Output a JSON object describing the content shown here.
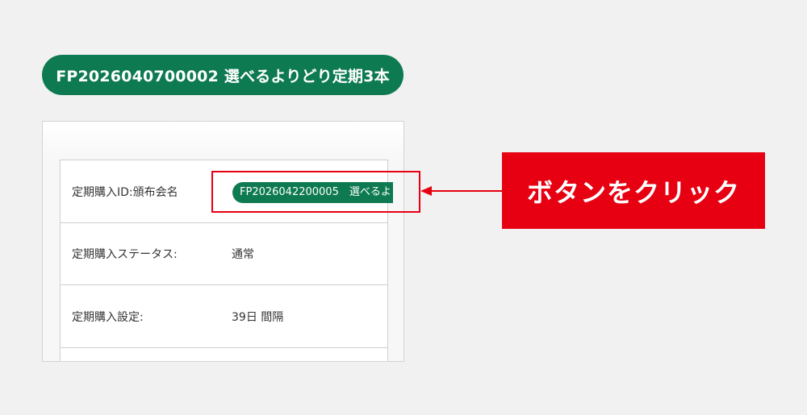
{
  "header_pill": {
    "text": "FP2026040700002 選べるよりどり定期3本"
  },
  "rows": [
    {
      "label": "定期購入ID:頒布会名",
      "value": "FP2026042200005　選べるよ"
    },
    {
      "label": "定期購入ステータス:",
      "value": "通常"
    },
    {
      "label": "定期購入設定:",
      "value": "39日 間隔"
    }
  ],
  "annotation": {
    "callout_text": "ボタンをクリック"
  },
  "colors": {
    "brand_green": "#0e7a52",
    "annotation_red": "#e60012",
    "background": "#f1f1f1"
  }
}
